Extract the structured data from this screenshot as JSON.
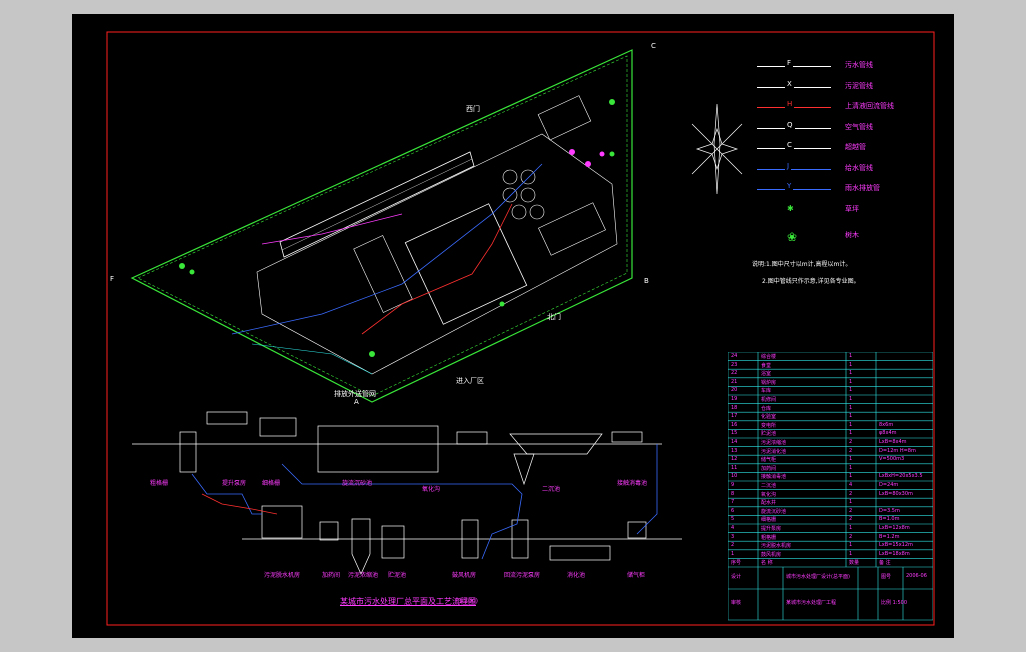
{
  "drawing": {
    "title": "某城市污水处理厂总平面及工艺流程图",
    "title_suffix": "(1:500)",
    "site_labels": {
      "gate_top": "西门",
      "gate_bottom": "北门",
      "inlet": "进入厂区",
      "outlet": "排放外送管网"
    },
    "corner_labels": {
      "c": "C",
      "b": "B",
      "f": "F",
      "a": "A"
    },
    "notes": [
      "说明:1.图中尺寸以m计,高程以m计。",
      "2.图中管线只作示意,详见各专业图。"
    ]
  },
  "legend": [
    {
      "code": "F",
      "text": "污水管线",
      "color": "#ffffff"
    },
    {
      "code": "X",
      "text": "污泥管线",
      "color": "#ffffff"
    },
    {
      "code": "H",
      "text": "上清液回流管线",
      "color": "#ff3030"
    },
    {
      "code": "Q",
      "text": "空气管线",
      "color": "#ffffff"
    },
    {
      "code": "C",
      "text": "超越管",
      "color": "#ffffff"
    },
    {
      "code": "J",
      "text": "给水管线",
      "color": "#3a6bff"
    },
    {
      "code": "Y",
      "text": "雨水排放管",
      "color": "#3a6bff"
    }
  ],
  "legend_symbols": [
    {
      "text": "草坪"
    },
    {
      "text": "树木"
    }
  ],
  "process_labels": {
    "top": [
      "粗格栅",
      "提升泵房",
      "细格栅",
      "旋流沉砂池",
      "氧化沟",
      "二沉池",
      "接触消毒池"
    ],
    "bottom": [
      "污泥脱水机房",
      "加药间",
      "污泥浓缩池",
      "贮泥池",
      "鼓风机房",
      "回流污泥泵房",
      "消化池",
      "储气柜"
    ]
  },
  "table": {
    "rows": [
      [
        "24",
        "综合楼",
        "1",
        ""
      ],
      [
        "23",
        "食堂",
        "1",
        ""
      ],
      [
        "22",
        "浴室",
        "1",
        ""
      ],
      [
        "21",
        "锅炉房",
        "1",
        ""
      ],
      [
        "20",
        "车库",
        "1",
        ""
      ],
      [
        "19",
        "机修间",
        "1",
        ""
      ],
      [
        "18",
        "仓库",
        "1",
        ""
      ],
      [
        "17",
        "化验室",
        "1",
        ""
      ],
      [
        "16",
        "变电所",
        "1",
        "8x6m"
      ],
      [
        "15",
        "贮泥池",
        "1",
        "φ8x4m"
      ],
      [
        "14",
        "污泥浓缩池",
        "2",
        "LxB=8x4m"
      ],
      [
        "13",
        "污泥消化池",
        "2",
        "D=12m H=8m"
      ],
      [
        "12",
        "储气柜",
        "1",
        "V=500m3"
      ],
      [
        "11",
        "加药间",
        "1",
        ""
      ],
      [
        "10",
        "接触消毒池",
        "1",
        "LxBxH=20x5x3.5"
      ],
      [
        "9",
        "二沉池",
        "4",
        "D=24m"
      ],
      [
        "8",
        "氧化沟",
        "2",
        "LxB=80x30m"
      ],
      [
        "7",
        "配水井",
        "1",
        ""
      ],
      [
        "6",
        "旋流沉砂池",
        "2",
        "D=3.5m"
      ],
      [
        "5",
        "细格栅",
        "2",
        "B=1.0m"
      ],
      [
        "4",
        "提升泵房",
        "1",
        "LxB=12x8m"
      ],
      [
        "3",
        "粗格栅",
        "2",
        "B=1.2m"
      ],
      [
        "2",
        "污泥脱水机房",
        "1",
        "LxB=15x12m"
      ],
      [
        "1",
        "鼓风机房",
        "1",
        "LxB=18x8m"
      ],
      [
        "序号",
        "名 称",
        "数量",
        "备 注"
      ]
    ],
    "footer": {
      "left_a": "设计",
      "left_b": "审核",
      "center_a": "城市污水处理厂设计(总平面)",
      "center_b": "某城市污水处理厂工程",
      "right_a": "图号",
      "right_b": "2006-06",
      "right_c": "比例 1:500"
    }
  },
  "colors": {
    "frame": "#ff2020",
    "green": "#39e639",
    "white": "#ffffff",
    "blue": "#3a6bff",
    "magenta": "#ff3cff",
    "cyan": "#2ee6e6",
    "red": "#ff3030"
  }
}
